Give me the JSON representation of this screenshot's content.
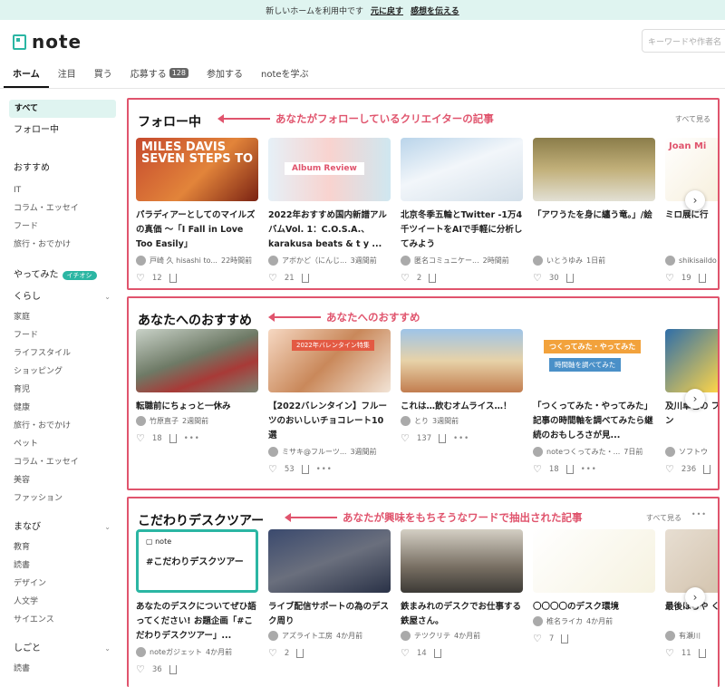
{
  "topbar": {
    "message": "新しいホームを利用中です",
    "back_link": "元に戻す",
    "feedback_link": "感想を伝える"
  },
  "header": {
    "logo_text": "note",
    "search_placeholder": "キーワードや作者名"
  },
  "tabs": [
    {
      "label": "ホーム",
      "active": true
    },
    {
      "label": "注目"
    },
    {
      "label": "買う"
    },
    {
      "label": "応募する",
      "badge": "128"
    },
    {
      "label": "参加する"
    },
    {
      "label": "noteを学ぶ"
    }
  ],
  "sidebar": {
    "all": "すべて",
    "following": "フォロー中",
    "osusume_head": "おすすめ",
    "osusume_items": [
      "IT",
      "コラム・エッセイ",
      "フード",
      "旅行・おでかけ"
    ],
    "yattemita": "やってみた",
    "yattemita_badge": "イチオシ",
    "kurashi_head": "くらし",
    "kurashi_items": [
      "家庭",
      "フード",
      "ライフスタイル",
      "ショッピング",
      "育児",
      "健康",
      "旅行・おでかけ",
      "ペット",
      "コラム・エッセイ",
      "美容",
      "ファッション"
    ],
    "manabi_head": "まなび",
    "manabi_items": [
      "教育",
      "読書",
      "デザイン",
      "人文学",
      "サイエンス"
    ],
    "shigoto_head": "しごと",
    "shigoto_items": [
      "読書"
    ]
  },
  "sections": [
    {
      "title": "フォロー中",
      "annotation": "あなたがフォローしているクリエイターの記事",
      "see_all": "すべて見る",
      "cards": [
        {
          "title": "パラディアーとしてのマイルズの真価 〜「I Fall in Love Too Easily」",
          "author": "戸崎 久 hisashi to...",
          "time": "22時間前",
          "likes": "12",
          "thumb_text": "MILES DAVIS SEVEN STEPS TO"
        },
        {
          "title": "2022年おすすめ国内新譜アルバムVol. 1：C.O.S.A.、karakusa beats & t y ...",
          "author": "アボかど（にんじ...",
          "time": "3週間前",
          "likes": "21",
          "thumb_text": "Album Review"
        },
        {
          "title": "北京冬季五輪とTwitter -1万4千ツイートをAIで手軽に分析してみよう",
          "author": "匿名コミュニケー...",
          "time": "2時間前",
          "likes": "2",
          "thumb_text": ""
        },
        {
          "title": "「アワうたを身に纏う竜。」/絵",
          "author": "いとうゆみ",
          "time": "1日前",
          "likes": "30",
          "thumb_text": ""
        },
        {
          "title": "ミロ展に行",
          "author": "shikisaildo",
          "time": "",
          "likes": "19",
          "thumb_text": "Joan Mi"
        }
      ]
    },
    {
      "title": "あなたへのおすすめ",
      "annotation": "あなたへのおすすめ",
      "see_all": "",
      "cards": [
        {
          "title": "転職前にちょっと一休み",
          "author": "竹原直子",
          "time": "2週間前",
          "likes": "18",
          "thumb_text": ""
        },
        {
          "title": "【2022バレンタイン】フルーツのおいしいチョコレート10選",
          "author": "ミサキ@フルーツ...",
          "time": "3週間前",
          "likes": "53",
          "thumb_text": "2022年バレンタイン特集"
        },
        {
          "title": "これは…飲むオムライス…！",
          "author": "とり",
          "time": "3週間前",
          "likes": "137",
          "thumb_text": ""
        },
        {
          "title": "「つくってみた・やってみた」記事の時間軸を調べてみたら継続のおもしろさが見...",
          "author": "noteつくってみた・...",
          "time": "7日前",
          "likes": "18",
          "thumb_text": "つくってみた・やってみた"
        },
        {
          "title": "及川卓也の ファースト」 ターン",
          "author": "ソフトウ",
          "time": "",
          "likes": "236",
          "thumb_text": ""
        }
      ]
    },
    {
      "title": "こだわりデスクツアー",
      "annotation": "あなたが興味をもちそうなワードで抽出された記事",
      "see_all": "すべて見る",
      "cards": [
        {
          "title": "あなたのデスクについてぜひ語ってください! お題企画「#こだわりデスクツアー」...",
          "author": "noteガジェット",
          "time": "4か月前",
          "likes": "36",
          "thumb_text": "#こだわりデスクツアー"
        },
        {
          "title": "ライブ配信サポートの為のデスク周り",
          "author": "アズライト工房",
          "time": "4か月前",
          "likes": "2",
          "thumb_text": ""
        },
        {
          "title": "鉄まみれのデスクでお仕事する鉄屋さん。",
          "author": "テツクリテ",
          "time": "4か月前",
          "likes": "14",
          "thumb_text": ""
        },
        {
          "title": "〇〇〇〇のデスク環境",
          "author": "椎名ライカ",
          "time": "4か月前",
          "likes": "7",
          "thumb_text": ""
        },
        {
          "title": "最後ほちや く",
          "author": "有瀬川",
          "time": "",
          "likes": "11",
          "thumb_text": ""
        }
      ]
    }
  ],
  "colors": {
    "accent": "#2bb6a3",
    "annotation": "#e0546d"
  }
}
